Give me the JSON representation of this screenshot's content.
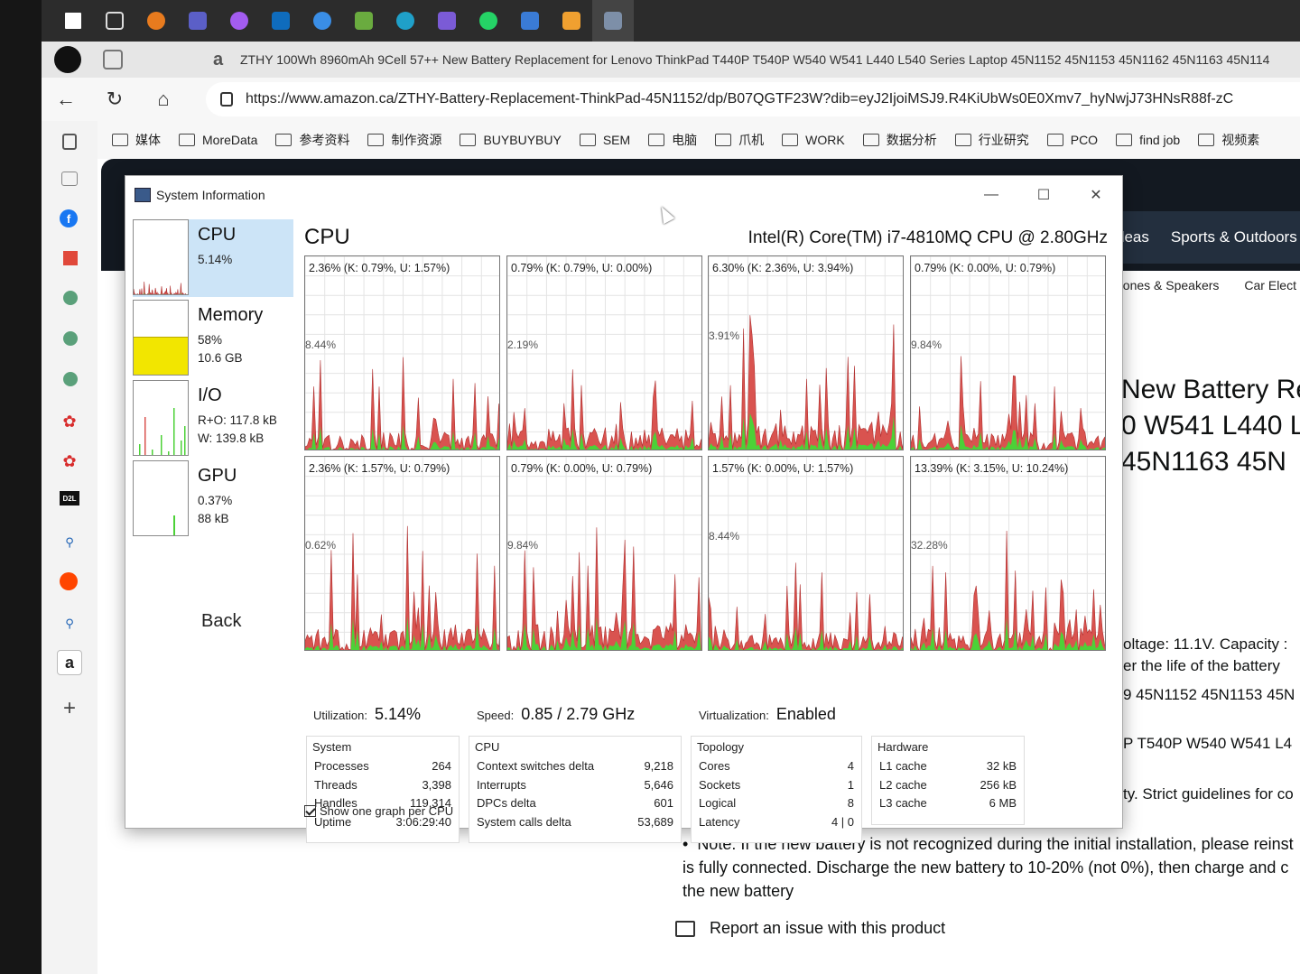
{
  "browser": {
    "tab_title": "ZTHY 100Wh 8960mAh 9Cell 57++ New Battery Replacement for Lenovo ThinkPad T440P T540P W540 W541 L440 L540 Series Laptop 45N1152 45N1153 45N1162 45N1163 45N114",
    "tab_favicon": "a",
    "url": "https://www.amazon.ca/ZTHY-Battery-Replacement-ThinkPad-45N1152/dp/B07QGTF23W?dib=eyJ2IjoiMSJ9.R4KiUbWs0E0Xmv7_hyNwjJ73HNsR88f-zC",
    "favorites": [
      "媒体",
      "MoreData",
      "参考资料",
      "制作资源",
      "BUYBUYBUY",
      "SEM",
      "电脑",
      "爪机",
      "WORK",
      "数据分析",
      "行业研究",
      "PCO",
      "find job",
      "视频素"
    ]
  },
  "amazon": {
    "nav_items": [
      "deas",
      "Sports & Outdoors"
    ],
    "sub_items": [
      "hones & Speakers",
      "Car Elect"
    ],
    "title_lines": [
      "New Battery Rep",
      "0 W541 L440 L",
      "45N1163 45N"
    ],
    "detail_lines": [
      "oltage: 11.1V. Capacity :",
      "er the life of the battery",
      "9 45N1152 45N1153 45N",
      "P T540P W540 W541 L4",
      "ty. Strict guidelines for co"
    ],
    "note": "Note: If the new battery is not recognized during the initial installation, please reinst is fully connected. Discharge the new battery to 10-20% (not 0%), then charge and c the new battery",
    "report": "Report an issue with this product",
    "sidebar_badge": "D2L"
  },
  "sysinfo": {
    "window_title": "System Information",
    "controls": {
      "minimize": "—",
      "maximize": "☐",
      "close": "✕"
    },
    "resources": [
      {
        "name": "CPU",
        "lines": [
          "5.14%"
        ]
      },
      {
        "name": "Memory",
        "lines": [
          "58%",
          "10.6 GB"
        ]
      },
      {
        "name": "I/O",
        "lines": [
          "R+O: 117.8 kB",
          "W: 139.8 kB"
        ]
      },
      {
        "name": "GPU",
        "lines": [
          "0.37%",
          "88 kB"
        ]
      }
    ],
    "back": "Back",
    "heading": "CPU",
    "model": "Intel(R) Core(TM) i7-4810MQ CPU @ 2.80GHz",
    "cores": [
      {
        "label": "2.36% (K: 0.79%, U: 1.57%)",
        "peak": "8.44%",
        "peak_value": 8.44
      },
      {
        "label": "0.79% (K: 0.79%, U: 0.00%)",
        "peak": "2.19%",
        "peak_value": 2.19
      },
      {
        "label": "6.30% (K: 2.36%, U: 3.94%)",
        "peak": "3.91%",
        "peak_value": 3.91
      },
      {
        "label": "0.79% (K: 0.00%, U: 0.79%)",
        "peak": "9.84%",
        "peak_value": 9.84
      },
      {
        "label": "2.36% (K: 1.57%, U: 0.79%)",
        "peak": "0.62%",
        "peak_value": 0.62
      },
      {
        "label": "0.79% (K: 0.00%, U: 0.79%)",
        "peak": "9.84%",
        "peak_value": 9.84
      },
      {
        "label": "1.57% (K: 0.00%, U: 1.57%)",
        "peak": "8.44%",
        "peak_value": 8.44
      },
      {
        "label": "13.39% (K: 3.15%, U: 10.24%)",
        "peak": "32.28%",
        "peak_value": 32.28
      }
    ],
    "utilization_label": "Utilization:",
    "utilization_value": "5.14%",
    "speed_label": "Speed:",
    "speed_value": "0.85 / 2.79 GHz",
    "virtualization_label": "Virtualization:",
    "virtualization_value": "Enabled",
    "groups": {
      "system": {
        "title": "System",
        "rows": [
          [
            "Processes",
            "264"
          ],
          [
            "Threads",
            "3,398"
          ],
          [
            "Handles",
            "119,314"
          ],
          [
            "Uptime",
            "3:06:29:40"
          ]
        ]
      },
      "cpu": {
        "title": "CPU",
        "rows": [
          [
            "Context switches delta",
            "9,218"
          ],
          [
            "Interrupts",
            "5,646"
          ],
          [
            "DPCs delta",
            "601"
          ],
          [
            "System calls delta",
            "53,689"
          ]
        ]
      },
      "topology": {
        "title": "Topology",
        "rows": [
          [
            "Cores",
            "4"
          ],
          [
            "Sockets",
            "1"
          ],
          [
            "Logical",
            "8"
          ],
          [
            "Latency",
            "4 | 0"
          ]
        ]
      },
      "hardware": {
        "title": "Hardware",
        "rows": [
          [
            "L1 cache",
            "32 kB"
          ],
          [
            "L2 cache",
            "256 kB"
          ],
          [
            "L3 cache",
            "6 MB"
          ]
        ]
      }
    },
    "show_one_graph": "Show one graph per CPU",
    "show_one_graph_checked": true,
    "colors": {
      "kernel": "#d9534f",
      "user": "#4cd137",
      "memory_fill": "#f2e600",
      "selection": "#cce4f7"
    }
  }
}
